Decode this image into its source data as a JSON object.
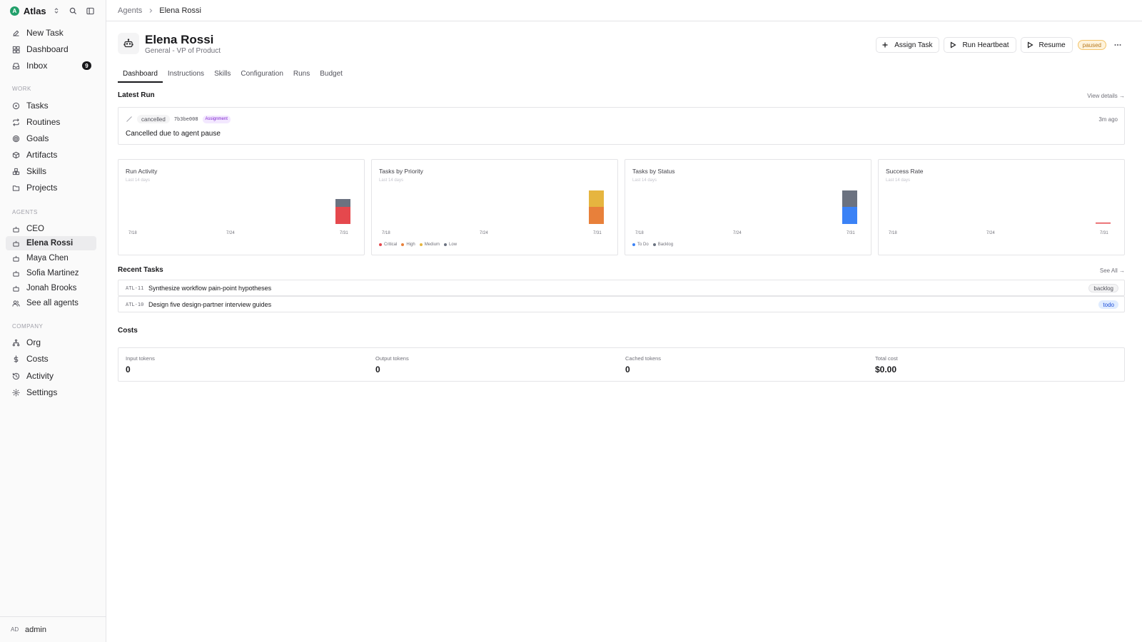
{
  "sidebar": {
    "brand": {
      "initial": "A",
      "name": "Atlas"
    },
    "top_items": [
      {
        "label": "New Task",
        "icon": "edit-icon"
      },
      {
        "label": "Dashboard",
        "icon": "dashboard-icon"
      },
      {
        "label": "Inbox",
        "icon": "inbox-icon",
        "badge": "9"
      }
    ],
    "work_label": "WORK",
    "work_items": [
      {
        "label": "Tasks",
        "icon": "circle-icon"
      },
      {
        "label": "Routines",
        "icon": "repeat-icon"
      },
      {
        "label": "Goals",
        "icon": "target-icon"
      },
      {
        "label": "Artifacts",
        "icon": "box-icon"
      },
      {
        "label": "Skills",
        "icon": "boxes-icon"
      },
      {
        "label": "Projects",
        "icon": "folder-icon"
      }
    ],
    "agents_label": "AGENTS",
    "agents": [
      {
        "label": "CEO"
      },
      {
        "label": "Elena Rossi",
        "active": true
      },
      {
        "label": "Maya Chen"
      },
      {
        "label": "Sofia Martinez"
      },
      {
        "label": "Jonah Brooks"
      },
      {
        "label": "See all agents"
      }
    ],
    "company_label": "COMPANY",
    "company_items": [
      {
        "label": "Org",
        "icon": "org-icon"
      },
      {
        "label": "Costs",
        "icon": "dollar-icon"
      },
      {
        "label": "Activity",
        "icon": "history-icon"
      },
      {
        "label": "Settings",
        "icon": "gear-icon"
      }
    ],
    "footer": {
      "initials": "AD",
      "name": "admin"
    }
  },
  "breadcrumb": {
    "parent": "Agents",
    "current": "Elena Rossi"
  },
  "agent": {
    "name": "Elena Rossi",
    "role": "General - VP of Product",
    "status": "paused"
  },
  "actions": {
    "assign": "Assign Task",
    "heartbeat": "Run Heartbeat",
    "resume": "Resume"
  },
  "tabs": [
    "Dashboard",
    "Instructions",
    "Skills",
    "Configuration",
    "Runs",
    "Budget"
  ],
  "latest_run": {
    "title": "Latest Run",
    "link": "View details →",
    "status": "cancelled",
    "id": "7b3be008",
    "tag": "Assignment",
    "time": "3m ago",
    "message": "Cancelled due to agent pause"
  },
  "charts": [
    {
      "title": "Run Activity",
      "subtitle": "Last 14 days",
      "x_ticks": [
        "7/18",
        "7/24",
        "7/31"
      ],
      "stacks": [
        {
          "value": 1,
          "color": "#e5484d"
        },
        {
          "value": 0.5,
          "color": "#6b7280"
        }
      ],
      "legend": []
    },
    {
      "title": "Tasks by Priority",
      "subtitle": "Last 14 days",
      "x_ticks": [
        "7/18",
        "7/24",
        "7/31"
      ],
      "stacks": [
        {
          "value": 1,
          "color": "#e8803a"
        },
        {
          "value": 1,
          "color": "#e6b53f"
        }
      ],
      "legend": [
        {
          "label": "Critical",
          "color": "#e5484d"
        },
        {
          "label": "High",
          "color": "#e8803a"
        },
        {
          "label": "Medium",
          "color": "#e6b53f"
        },
        {
          "label": "Low",
          "color": "#6b7280"
        }
      ]
    },
    {
      "title": "Tasks by Status",
      "subtitle": "Last 14 days",
      "x_ticks": [
        "7/18",
        "7/24",
        "7/31"
      ],
      "stacks": [
        {
          "value": 1,
          "color": "#3b82f6"
        },
        {
          "value": 1,
          "color": "#6b7280"
        }
      ],
      "legend": [
        {
          "label": "To Do",
          "color": "#3b82f6"
        },
        {
          "label": "Backlog",
          "color": "#6b7280"
        }
      ]
    },
    {
      "title": "Success Rate",
      "subtitle": "Last 14 days",
      "x_ticks": [
        "7/18",
        "7/24",
        "7/31"
      ],
      "stacks": [],
      "success_value": 0,
      "legend": []
    }
  ],
  "recent_tasks": {
    "title": "Recent Tasks",
    "link": "See All →",
    "items": [
      {
        "id": "ATL-11",
        "title": "Synthesize workflow pain-point hypotheses",
        "status": "backlog"
      },
      {
        "id": "ATL-10",
        "title": "Design five design-partner interview guides",
        "status": "todo"
      }
    ]
  },
  "costs": {
    "title": "Costs",
    "items": [
      {
        "label": "Input tokens",
        "value": "0"
      },
      {
        "label": "Output tokens",
        "value": "0"
      },
      {
        "label": "Cached tokens",
        "value": "0"
      },
      {
        "label": "Total cost",
        "value": "$0.00"
      }
    ]
  }
}
